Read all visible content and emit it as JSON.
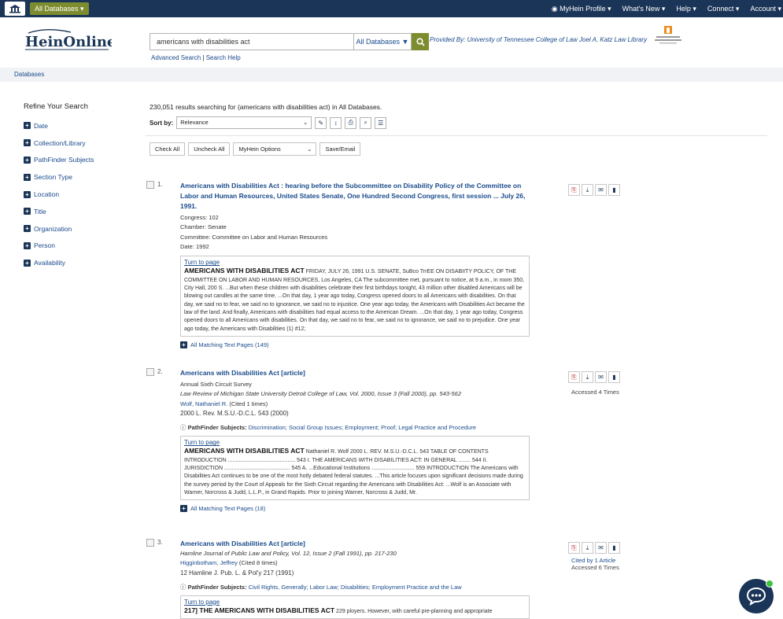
{
  "topbar": {
    "db_button": "All Databases ▾",
    "profile": "MyHein Profile ▾",
    "whats_new": "What's New ▾",
    "help": "Help ▾",
    "connect": "Connect ▾",
    "account": "Account ▾"
  },
  "header": {
    "logo": "HeinOnline",
    "search_value": "americans with disabilities act",
    "db_select": "All Databases ▼",
    "advanced": "Advanced Search",
    "search_help": "Search Help",
    "separator": "|",
    "provided": "Provided By: University of Tennessee College of Law Joel A. Katz Law Library"
  },
  "breadcrumb": "Databases",
  "refine": {
    "heading": "Refine Your Search",
    "items": [
      "Date",
      "Collection/Library",
      "PathFinder Subjects",
      "Section Type",
      "Location",
      "Title",
      "Organization",
      "Person",
      "Availability"
    ]
  },
  "results_summary": "230,051 results searching for (americans with disabilities act) in All Databases.",
  "sort": {
    "label": "Sort by:",
    "value": "Relevance"
  },
  "actions": {
    "check_all": "Check All",
    "uncheck_all": "Uncheck All",
    "myhein_options": "MyHein Options",
    "save_email": "Save/Email"
  },
  "results": [
    {
      "num": "1.",
      "title": "Americans with Disabilities Act : hearing before the Subcommittee on Disability Policy of the Committee on Labor and Human Resources, United States Senate, One Hundred Second Congress, first session ... July 26, 1991.",
      "meta": [
        "Congress: 102",
        "Chamber: Senate",
        "Committee: Committee on Labor and Human Resources",
        "Date: 1992"
      ],
      "turn": "Turn to page",
      "snippet_head": "AMERICANS WITH DISABILITIES ACT",
      "snippet": " FRIDAY, JULY 26, 1991 U.S. SENATE, SuBco TrrEE ON DISABIITY POLICY, OF THE COMMITTEE ON LABOR AND HUMAN RESOURCES, Los Angeles, CA The subcommittee met, pursuant to notice, at 9 a.m., in room 350, City Hall, 200 S. ...But when these children with disabilities celebrate their first birthdays tonight, 43 million other disabled Americans will be blowing out candles at the same time. ...On that day, 1 year ago today, Congress opened doors to all Americans with disabilities. On that day, we said no to fear, we said no to ignorance, we said no to injustice. One year ago today, the Americans with Disabilities Act became the law of the land. And finally, Americans with disabilities had equal access to the American Dream. ...On that day, 1 year ago today, Congress opened doors to all Americans with disabilities. On that day, we said no to fear, we said no to ignorance, we said no to prejudice. One year ago today, the Americans with Disabilities (1) #12;",
      "matching": "All Matching Text Pages (149)"
    },
    {
      "num": "2.",
      "title": "Americans with Disabilities Act [article]",
      "meta": [
        "Annual Sixth Circuit Survey"
      ],
      "journal": "Law Review of Michigan State University Detroit College of Law, Vol. 2000, Issue 3 (Fall 2000), pp. 543-562",
      "author": "Wolf, Nathaniel R.",
      "cited": " (Cited 1 times)",
      "cite": "2000 L. Rev. M.S.U.-D.C.L. 543 (2000)",
      "pf_label": "PathFinder Subjects:",
      "pf_values": "Discrimination; Social Group Issues; Employment; Proof; Legal Practice and Procedure",
      "turn": "Turn to page",
      "snippet_head": "AMERICANS WITH DISABILITIES ACT",
      "snippet": " Nathaniel R. Wolf 2000 L. REV. M.S.U.-D.C.L. 543 TABLE OF CONTENTS INTRODUCTION ............................................ 543 I. THE AMERICANS WITH DISABILITIES ACT: IN GENERAL ........ 544 II. JURISDICTION ........................................... 545 A. ...Educational Institutions ............................ 559 INTRODUCTION The Americans with Disabilities Act continues to be one of the most hotly debated federal statutes. ...This article focuses upon significant decisions made during the survey period by the Court of Appeals for the Sixth Circuit regarding the Americans with Disabilities Act: ...Wolf is an Associate with Warner, Norcross & Judd, L.L.P., in Grand Rapids. Prior to joining Warner, Norcross & Judd, Mr.",
      "matching": "All Matching Text Pages (18)",
      "accessed": "Accessed 4 Times"
    },
    {
      "num": "3.",
      "title": "Americans with Disabilities Act [article]",
      "journal": "Hamline Journal of Public Law and Policy, Vol. 12, Issue 2 (Fall 1991), pp. 217-230",
      "author": "Higginbotham, Jeffrey",
      "cited": " (Cited 8 times)",
      "cite": "12 Hamline J. Pub. L. & Pol'y 217 (1991)",
      "pf_label": "PathFinder Subjects:",
      "pf_values": "Civil Rights, Generally; Labor Law; Disabilities; Employment Practice and the Law",
      "turn": "Turn to page",
      "snippet_head": "217] THE AMERICANS WITH DISABILITIES ACT",
      "snippet": " 229 ployers. However, with careful pre-planning and appropriate",
      "cited_by": "Cited by 1 Article",
      "accessed": "Accessed 6 Times"
    }
  ]
}
